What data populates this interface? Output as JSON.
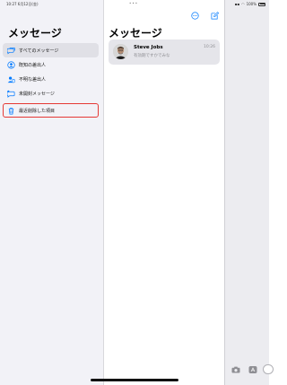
{
  "status_bar": {
    "time_date": "10:27  6月12日(金)",
    "center_dots": "•••",
    "battery": "100%"
  },
  "sidebar": {
    "title": "メッセージ",
    "filters": [
      {
        "label": "すべてのメッセージ",
        "icon": "chat-bubbles-icon",
        "active": true
      },
      {
        "label": "既知の差出人",
        "icon": "person-circle-icon",
        "active": false
      },
      {
        "label": "不明な差出人",
        "icon": "person-question-icon",
        "active": false
      },
      {
        "label": "未開封メッセージ",
        "icon": "unread-bubble-icon",
        "active": false
      }
    ],
    "deleted": {
      "label": "最近削除した項目",
      "icon": "trash-icon"
    }
  },
  "conversations": {
    "title": "メッセージ",
    "items": [
      {
        "name": "Steve Jobs",
        "time": "10:26",
        "preview": "有効期ですかでみな"
      }
    ]
  },
  "colors": {
    "accent": "#007aff",
    "highlight": "#e53935",
    "sidebar_bg": "#f2f2f7",
    "selected_row": "#e5e5ea"
  }
}
